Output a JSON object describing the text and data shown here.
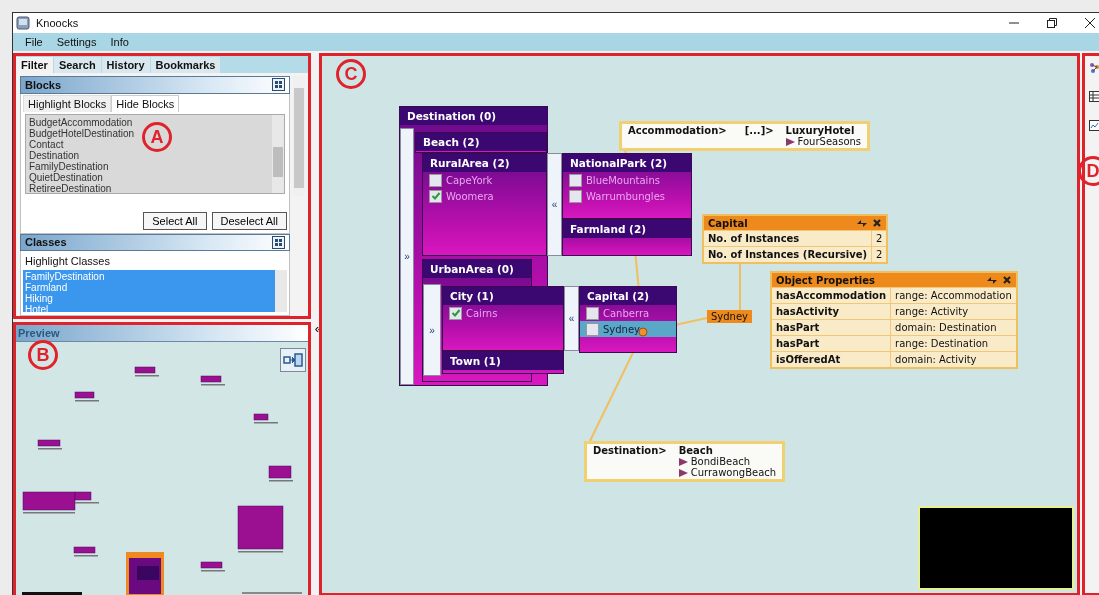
{
  "window": {
    "title": "Knoocks"
  },
  "menu": [
    "File",
    "Settings",
    "Info"
  ],
  "filter_panel": {
    "tabs": [
      {
        "label": "Filter",
        "selected": true
      },
      {
        "label": "Search",
        "selected": false
      },
      {
        "label": "History",
        "selected": false
      },
      {
        "label": "Bookmarks",
        "selected": false
      }
    ],
    "blocks": {
      "title": "Blocks",
      "tabs": [
        {
          "label": "Highlight Blocks",
          "selected": false
        },
        {
          "label": "Hide Blocks",
          "selected": true
        }
      ],
      "items": [
        "BudgetAccommodation",
        "BudgetHotelDestination",
        "Contact",
        "Destination",
        "FamilyDestination",
        "QuietDestination",
        "RetireeDestination"
      ],
      "buttons": [
        "Select All",
        "Deselect All"
      ]
    },
    "classes": {
      "title": "Classes",
      "label": "Highlight Classes",
      "items": [
        {
          "label": "FamilyDestination",
          "selected": true
        },
        {
          "label": "Farmland",
          "selected": true
        },
        {
          "label": "Hiking",
          "selected": true
        },
        {
          "label": "Hotel",
          "selected": true
        }
      ]
    }
  },
  "preview": {
    "title": "Preview",
    "collapse": "«"
  },
  "canvas": {
    "blocks": [
      {
        "title": "Destination (0)",
        "toggle": "»",
        "children": [
          {
            "title": "Beach (2)"
          },
          {
            "title": "RuralArea (2)",
            "toggle": "«",
            "instances": [
              {
                "label": "CapeYork",
                "checked": false,
                "selected": false
              },
              {
                "label": "Woomera",
                "checked": true,
                "selected": false
              }
            ],
            "children": [
              {
                "title": "NationalPark (2)",
                "instances": [
                  {
                    "label": "BlueMountains",
                    "checked": false,
                    "selected": false
                  },
                  {
                    "label": "Warrumbungles",
                    "checked": false,
                    "selected": false
                  }
                ]
              },
              {
                "title": "Farmland (2)"
              }
            ]
          },
          {
            "title": "UrbanArea (0)",
            "toggle": "»",
            "children": [
              {
                "title": "City (1)",
                "toggle": "«",
                "instances": [
                  {
                    "label": "Cairns",
                    "checked": true,
                    "selected": false
                  }
                ],
                "children": [
                  {
                    "title": "Capital (2)",
                    "instances": [
                      {
                        "label": "Canberra",
                        "checked": false,
                        "selected": false
                      },
                      {
                        "label": "Sydney",
                        "checked": false,
                        "selected": true
                      }
                    ]
                  }
                ]
              },
              {
                "title": "Town (1)"
              }
            ]
          }
        ]
      }
    ],
    "paths": [
      {
        "steps": [
          "Accommodation>",
          "[...]>"
        ],
        "target": "LuxuryHotel",
        "instances": [
          "FourSeasons"
        ]
      },
      {
        "steps": [
          "Destination>"
        ],
        "target": "Beach",
        "instances": [
          "BondiBeach",
          "CurrawongBeach"
        ]
      }
    ],
    "info_boxes": [
      {
        "title": "Capital",
        "rows": [
          [
            "No. of Instances",
            "2"
          ],
          [
            "No. of Instances (Recursive)",
            "2"
          ]
        ]
      },
      {
        "title": "Object Properties",
        "rows": [
          [
            "hasAccommodation",
            "range: Accommodation"
          ],
          [
            "hasActivity",
            "range: Activity"
          ],
          [
            "hasPart",
            "domain: Destination"
          ],
          [
            "hasPart",
            "range: Destination"
          ],
          [
            "isOfferedAt",
            "domain: Activity"
          ]
        ]
      }
    ],
    "tag": {
      "label": "Sydney"
    }
  },
  "annotations": [
    {
      "label": "A"
    },
    {
      "label": "B"
    },
    {
      "label": "C"
    },
    {
      "label": "D"
    }
  ]
}
